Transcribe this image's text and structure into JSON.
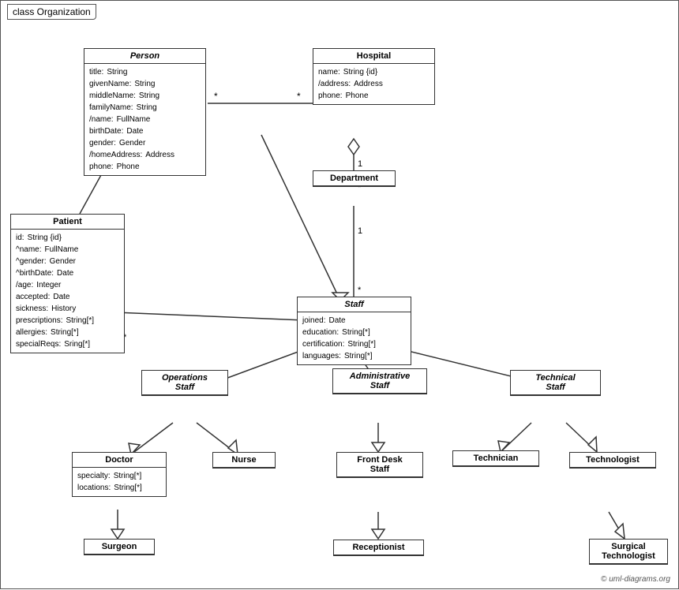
{
  "title": "class Organization",
  "copyright": "© uml-diagrams.org",
  "boxes": {
    "person": {
      "label": "Person",
      "attrs": [
        {
          "name": "title:",
          "type": "String"
        },
        {
          "name": "givenName:",
          "type": "String"
        },
        {
          "name": "middleName:",
          "type": "String"
        },
        {
          "name": "familyName:",
          "type": "String"
        },
        {
          "name": "/name:",
          "type": "FullName"
        },
        {
          "name": "birthDate:",
          "type": "Date"
        },
        {
          "name": "gender:",
          "type": "Gender"
        },
        {
          "name": "/homeAddress:",
          "type": "Address"
        },
        {
          "name": "phone:",
          "type": "Phone"
        }
      ]
    },
    "hospital": {
      "label": "Hospital",
      "attrs": [
        {
          "name": "name:",
          "type": "String {id}"
        },
        {
          "name": "/address:",
          "type": "Address"
        },
        {
          "name": "phone:",
          "type": "Phone"
        }
      ]
    },
    "department": {
      "label": "Department",
      "attrs": []
    },
    "patient": {
      "label": "Patient",
      "attrs": [
        {
          "name": "id:",
          "type": "String {id}"
        },
        {
          "name": "^name:",
          "type": "FullName"
        },
        {
          "name": "^gender:",
          "type": "Gender"
        },
        {
          "name": "^birthDate:",
          "type": "Date"
        },
        {
          "name": "/age:",
          "type": "Integer"
        },
        {
          "name": "accepted:",
          "type": "Date"
        },
        {
          "name": "sickness:",
          "type": "History"
        },
        {
          "name": "prescriptions:",
          "type": "String[*]"
        },
        {
          "name": "allergies:",
          "type": "String[*]"
        },
        {
          "name": "specialReqs:",
          "type": "Sring[*]"
        }
      ]
    },
    "staff": {
      "label": "Staff",
      "attrs": [
        {
          "name": "joined:",
          "type": "Date"
        },
        {
          "name": "education:",
          "type": "String[*]"
        },
        {
          "name": "certification:",
          "type": "String[*]"
        },
        {
          "name": "languages:",
          "type": "String[*]"
        }
      ]
    },
    "ops_staff": {
      "label": "Operations\nStaff",
      "attrs": []
    },
    "admin_staff": {
      "label": "Administrative\nStaff",
      "attrs": []
    },
    "tech_staff": {
      "label": "Technical\nStaff",
      "attrs": []
    },
    "doctor": {
      "label": "Doctor",
      "attrs": [
        {
          "name": "specialty:",
          "type": "String[*]"
        },
        {
          "name": "locations:",
          "type": "String[*]"
        }
      ]
    },
    "nurse": {
      "label": "Nurse",
      "attrs": []
    },
    "front_desk": {
      "label": "Front Desk\nStaff",
      "attrs": []
    },
    "technician": {
      "label": "Technician",
      "attrs": []
    },
    "technologist": {
      "label": "Technologist",
      "attrs": []
    },
    "surgeon": {
      "label": "Surgeon",
      "attrs": []
    },
    "receptionist": {
      "label": "Receptionist",
      "attrs": []
    },
    "surgical_technologist": {
      "label": "Surgical\nTechnologist",
      "attrs": []
    }
  }
}
